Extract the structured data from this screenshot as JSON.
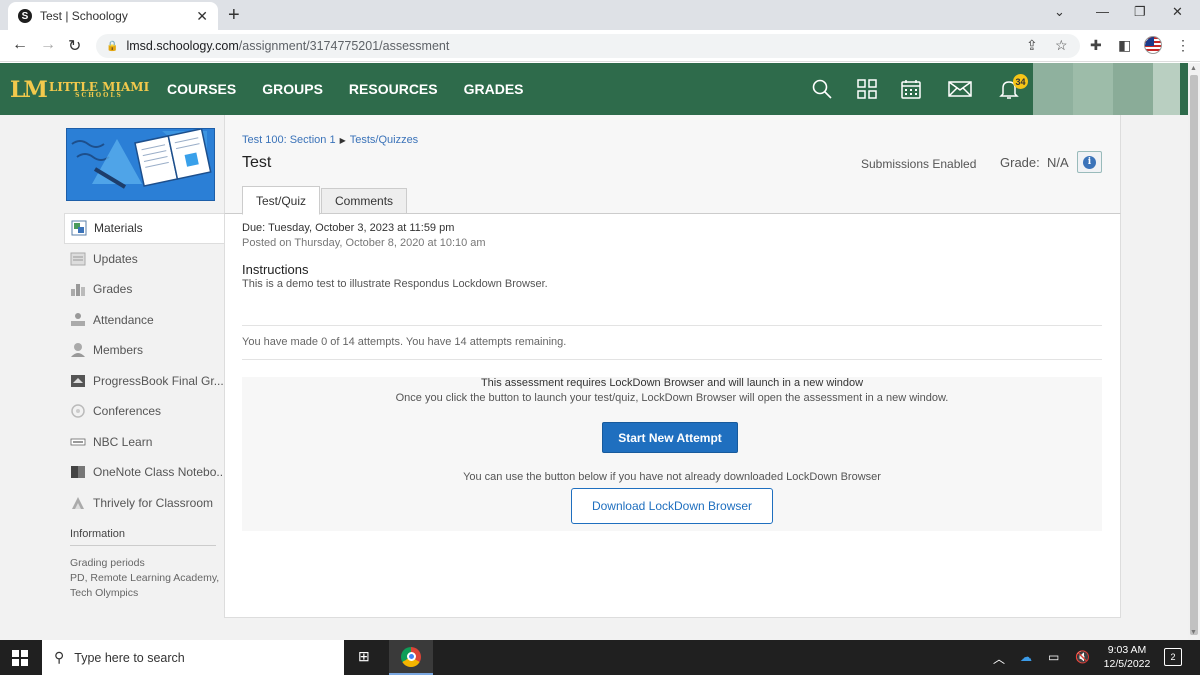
{
  "browser": {
    "tab_title": "Test | Schoology",
    "tab_favicon": "S",
    "tab_close": "✕",
    "new_tab": "+",
    "url_host": "lmsd.schoology.com",
    "url_path": "/assignment/3174775201/assessment",
    "icons": [
      "back-icon",
      "forward-icon",
      "reload-icon",
      "lock-icon",
      "share-icon",
      "star-icon",
      "extensions-icon",
      "sidepanel-icon",
      "profile-icon",
      "more-icon",
      "minimize-icon",
      "restore-icon",
      "close-icon",
      "tab-search-icon"
    ]
  },
  "header": {
    "logo_main": "LITTLE MIAMI",
    "logo_sub": "SCHOOLS",
    "logo_mark": "LM",
    "nav": [
      "COURSES",
      "GROUPS",
      "RESOURCES",
      "GRADES"
    ],
    "notification_count": "34",
    "icons": [
      "search-icon",
      "apps-grid-icon",
      "calendar-icon",
      "mail-icon",
      "bell-icon"
    ],
    "colors": {
      "bar": "#2e6b4b",
      "logo": "#f2c94c",
      "badge": "#f5c518"
    }
  },
  "sidebar": {
    "items": [
      {
        "label": "Materials",
        "icon": "materials-icon",
        "active": true
      },
      {
        "label": "Updates",
        "icon": "updates-icon"
      },
      {
        "label": "Grades",
        "icon": "grades-icon"
      },
      {
        "label": "Attendance",
        "icon": "attendance-icon"
      },
      {
        "label": "Members",
        "icon": "members-icon"
      },
      {
        "label": "ProgressBook Final Gr...",
        "icon": "progressbook-icon"
      },
      {
        "label": "Conferences",
        "icon": "conferences-icon"
      },
      {
        "label": "NBC Learn",
        "icon": "nbc-learn-icon"
      },
      {
        "label": "OneNote Class Notebo...",
        "icon": "onenote-icon"
      },
      {
        "label": "Thrively for Classroom",
        "icon": "thrively-icon"
      }
    ],
    "information_heading": "Information",
    "grading_periods_label": "Grading periods",
    "grading_periods_value": "PD, Remote Learning Academy, Tech Olympics"
  },
  "main": {
    "breadcrumb_course": "Test 100: Section 1",
    "breadcrumb_sep": "▶",
    "breadcrumb_folder": "Tests/Quizzes",
    "title": "Test",
    "submissions": "Submissions Enabled",
    "grade_label": "Grade:",
    "grade_value": "N/A",
    "tabs": [
      "Test/Quiz",
      "Comments"
    ],
    "due": "Due: Tuesday, October 3, 2023 at 11:59 pm",
    "posted": "Posted on Thursday, October 8, 2020 at 10:10 am",
    "instructions_heading": "Instructions",
    "instructions_body": "This is a demo test to illustrate Respondus Lockdown Browser.",
    "attempts": "You have made 0 of 14 attempts. You have 14 attempts remaining.",
    "lockdown_line1": "This assessment requires LockDown Browser and will launch in a new window",
    "lockdown_line2": "Once you click the button to launch your test/quiz, LockDown Browser will open the assessment in a new window.",
    "start_button": "Start New Attempt",
    "download_note": "You can use the button below if you have not already downloaded LockDown Browser",
    "download_button": "Download LockDown Browser",
    "colors": {
      "link": "#3b73b9",
      "primary_button": "#1f6fbf"
    }
  },
  "taskbar": {
    "search_placeholder": "Type here to search",
    "time": "9:03 AM",
    "date": "12/5/2022",
    "notifications": "2",
    "icons": [
      "windows-start-icon",
      "search-icon",
      "task-view-icon",
      "chrome-icon",
      "chevron-up-icon",
      "onedrive-icon",
      "battery-icon",
      "volume-muted-icon",
      "notification-center-icon"
    ]
  }
}
